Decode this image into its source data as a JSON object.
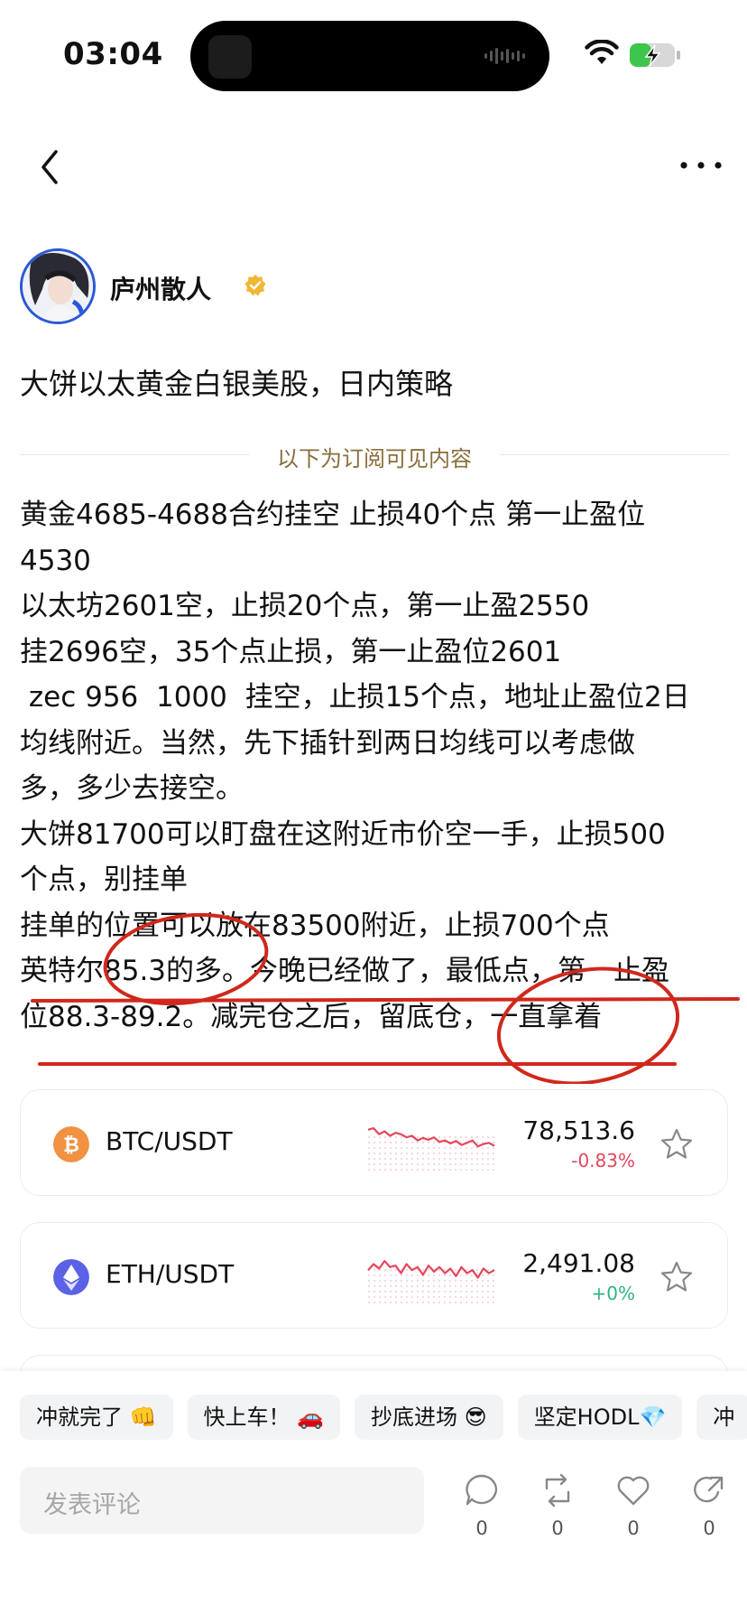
{
  "status": {
    "time": "03:04"
  },
  "author": {
    "name": "庐州散人"
  },
  "post": {
    "title": "大饼以太黄金白银美股，日内策略",
    "divider_text": "以下为订阅可见内容",
    "lines": [
      "黄金4685-4688合约挂空 止损40个点 第一止盈位",
      "4530",
      "以太坊2601空，止损20个点，第一止盈2550",
      "挂2696空，35个点止损，第一止盈位2601",
      " zec 956  1000  挂空，止损15个点，地址止盈位2日",
      "均线附近。当然，先下插针到两日均线可以考虑做",
      "多，多少去接空。",
      "大饼81700可以盯盘在这附近市价空一手，止损500",
      "个点，别挂单",
      "挂单的位置可以放在83500附近，止损700个点",
      "英特尔85.3的多。今晚已经做了，最低点，第一止盈",
      "位88.3-89.2。减完仓之后，留底仓，一直拿着"
    ]
  },
  "tickers": [
    {
      "pair": "BTC/USDT",
      "price": "78,513.6",
      "change": "-0.83%",
      "change_color": "#e2475c",
      "icon": "bitcoin-icon",
      "icon_color": "#f09242",
      "spark": [
        0.35,
        0.3,
        0.5,
        0.4,
        0.55,
        0.45,
        0.5,
        0.6,
        0.55,
        0.7,
        0.62,
        0.68,
        0.6,
        0.75,
        0.7,
        0.8,
        0.72,
        0.85,
        0.78,
        0.7,
        0.9,
        0.82,
        0.78,
        0.88
      ]
    },
    {
      "pair": "ETH/USDT",
      "price": "2,491.08",
      "change": "+0%",
      "change_color": "#2fb383",
      "icon": "ethereum-icon",
      "icon_color": "#5b62e6",
      "spark": [
        0.6,
        0.4,
        0.55,
        0.3,
        0.5,
        0.45,
        0.7,
        0.4,
        0.6,
        0.5,
        0.75,
        0.45,
        0.65,
        0.5,
        0.7,
        0.55,
        0.8,
        0.5,
        0.7,
        0.6,
        0.85,
        0.55,
        0.7,
        0.6
      ]
    }
  ],
  "quick_replies": [
    "冲就完了 👊",
    "快上车！ 🚗",
    "抄底进场 😎",
    "坚定HODL💎",
    "冲"
  ],
  "comment": {
    "placeholder": "发表评论"
  },
  "actions": [
    {
      "name": "comment",
      "count": "0"
    },
    {
      "name": "repost",
      "count": "0"
    },
    {
      "name": "like",
      "count": "0"
    },
    {
      "name": "share",
      "count": "0"
    }
  ],
  "colors": {
    "accent_gold": "#8a6d3b",
    "annotation_red": "#d0281c",
    "avatar_ring": "#2b58d6"
  }
}
